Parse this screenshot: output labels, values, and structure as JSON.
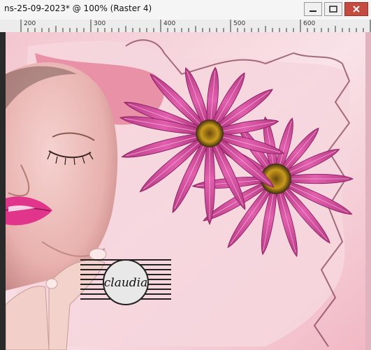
{
  "window": {
    "title": "ns-25-09-2023* @ 100% (Raster 4)",
    "buttons": [
      {
        "name": "minimize",
        "icon": "minimize-icon"
      },
      {
        "name": "maximize",
        "icon": "maximize-icon"
      },
      {
        "name": "close",
        "icon": "close-icon"
      }
    ]
  },
  "ruler": {
    "labels": [
      "200",
      "300",
      "400",
      "500",
      "600"
    ]
  },
  "canvas": {
    "watermark_text": "claudia"
  },
  "colors": {
    "accent_pink": "#d9467a",
    "petal_pink": "#c63d8e",
    "bg_light": "#f7dce3"
  }
}
